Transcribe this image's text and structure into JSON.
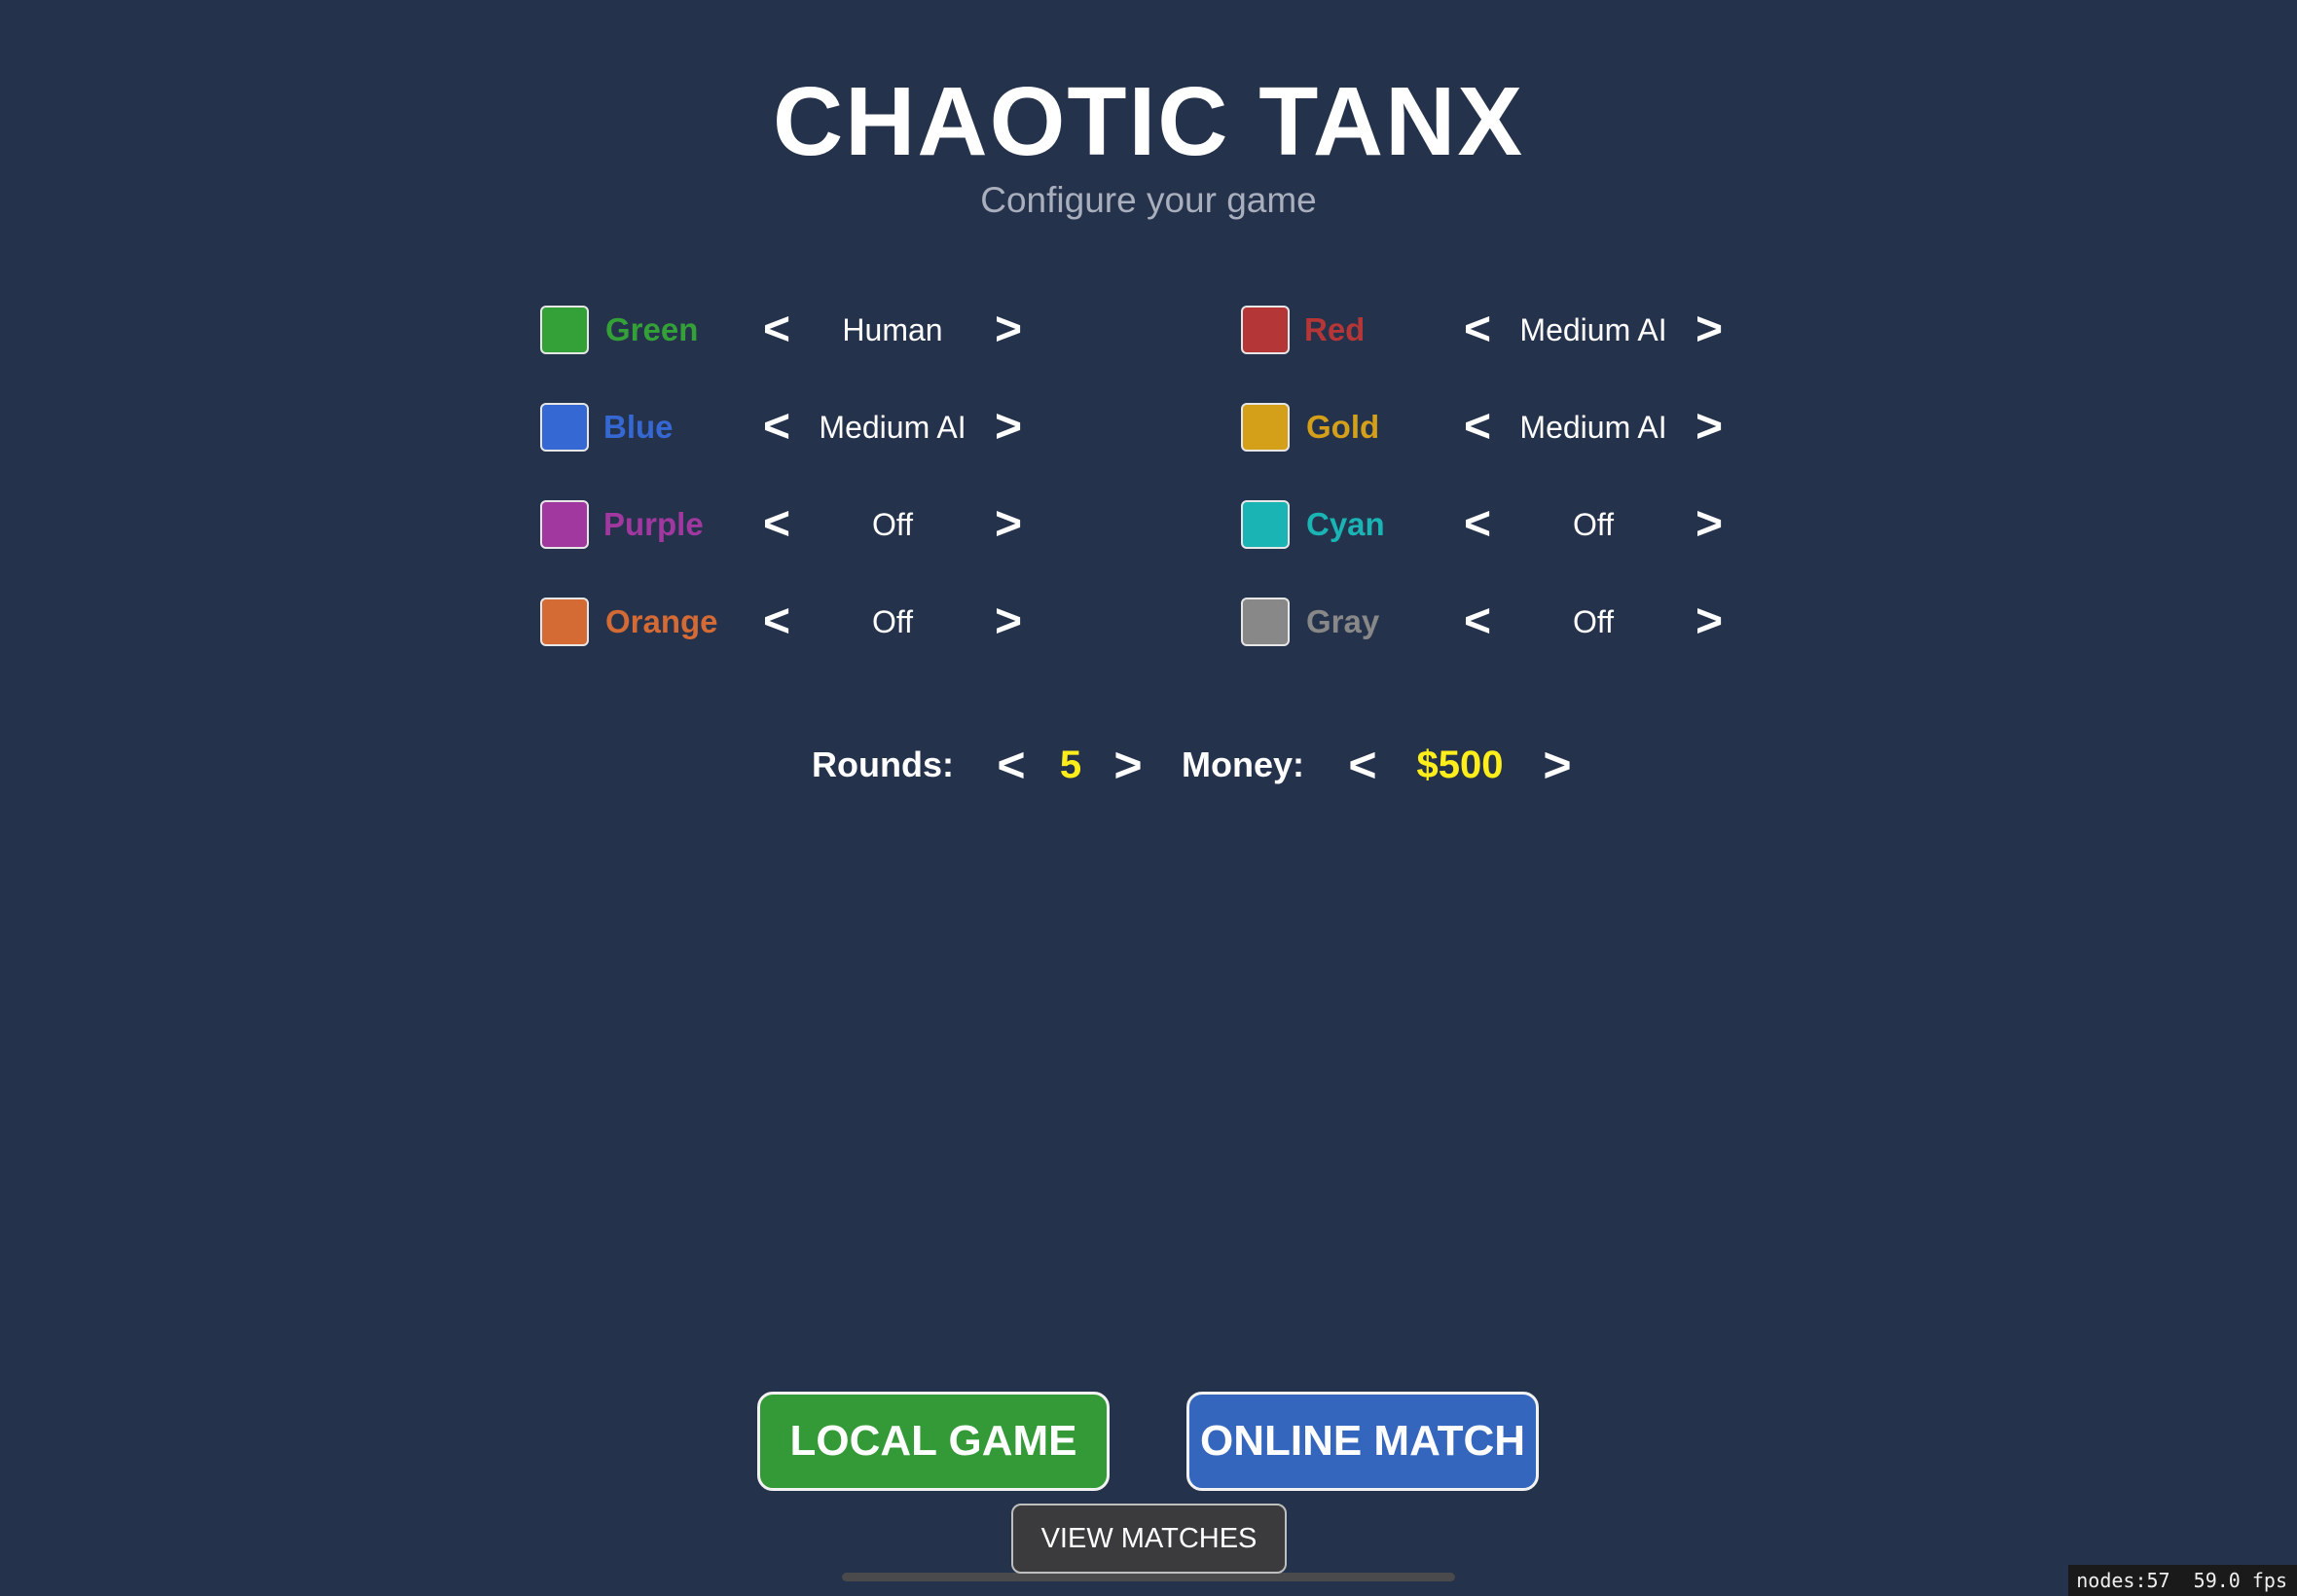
{
  "title": "CHAOTIC TANX",
  "subtitle": "Configure your game",
  "arrows": {
    "prev": "<",
    "next": ">"
  },
  "players": [
    {
      "name": "Green",
      "mode": "Human",
      "color": "#34a038"
    },
    {
      "name": "Red",
      "mode": "Medium AI",
      "color": "#b53636"
    },
    {
      "name": "Blue",
      "mode": "Medium AI",
      "color": "#3668d4"
    },
    {
      "name": "Gold",
      "mode": "Medium AI",
      "color": "#d4a019"
    },
    {
      "name": "Purple",
      "mode": "Off",
      "color": "#a038a0"
    },
    {
      "name": "Cyan",
      "mode": "Off",
      "color": "#1ab4b4"
    },
    {
      "name": "Orange",
      "mode": "Off",
      "color": "#d46a34"
    },
    {
      "name": "Gray",
      "mode": "Off",
      "color": "#888888"
    }
  ],
  "settings": {
    "rounds_label": "Rounds:",
    "rounds_value": "5",
    "money_label": "Money:",
    "money_value": "$500"
  },
  "buttons": {
    "local_game": "LOCAL GAME",
    "local_color": "#339a37",
    "online_match": "ONLINE MATCH",
    "online_color": "#3566bd",
    "view_matches": "VIEW MATCHES"
  },
  "debug": {
    "nodes": "nodes:57",
    "fps": "59.0 fps"
  }
}
